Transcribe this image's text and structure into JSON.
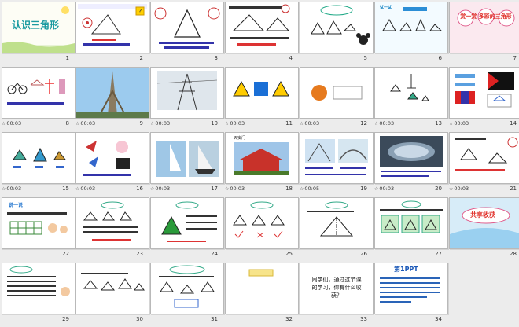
{
  "slides": [
    {
      "num": "1",
      "timing": "",
      "title": "认识三角形"
    },
    {
      "num": "2",
      "timing": ""
    },
    {
      "num": "3",
      "timing": ""
    },
    {
      "num": "4",
      "timing": ""
    },
    {
      "num": "5",
      "timing": ""
    },
    {
      "num": "6",
      "timing": "",
      "title": "试一试"
    },
    {
      "num": "7",
      "timing": "",
      "title": "赏一赏 多彩的三角形"
    },
    {
      "num": "8",
      "timing": "00:03"
    },
    {
      "num": "9",
      "timing": "00:03"
    },
    {
      "num": "10",
      "timing": "00:03"
    },
    {
      "num": "11",
      "timing": "00:03"
    },
    {
      "num": "12",
      "timing": "00:03"
    },
    {
      "num": "13",
      "timing": "00:03"
    },
    {
      "num": "14",
      "timing": "00:03"
    },
    {
      "num": "15",
      "timing": "00:03"
    },
    {
      "num": "16",
      "timing": "00:03"
    },
    {
      "num": "17",
      "timing": "00:03"
    },
    {
      "num": "18",
      "timing": "00:03",
      "title": "天安门"
    },
    {
      "num": "19",
      "timing": "00:05"
    },
    {
      "num": "20",
      "timing": "00:03"
    },
    {
      "num": "21",
      "timing": "00:03"
    },
    {
      "num": "22",
      "timing": "",
      "title": "说一说"
    },
    {
      "num": "23",
      "timing": ""
    },
    {
      "num": "24",
      "timing": ""
    },
    {
      "num": "25",
      "timing": ""
    },
    {
      "num": "26",
      "timing": ""
    },
    {
      "num": "27",
      "timing": ""
    },
    {
      "num": "28",
      "timing": "",
      "title": "共享收获"
    },
    {
      "num": "29",
      "timing": ""
    },
    {
      "num": "30",
      "timing": ""
    },
    {
      "num": "31",
      "timing": ""
    },
    {
      "num": "32",
      "timing": ""
    },
    {
      "num": "33",
      "timing": "",
      "title": "同学们，通过这节课的学习，你有什么收获？"
    },
    {
      "num": "34",
      "timing": "",
      "title": "第1PPT"
    }
  ],
  "colors": {
    "bg": "#ececec",
    "slide_border": "#b9b9b9",
    "title_teal": "#1a9aa0",
    "accent_red": "#e0302a"
  }
}
